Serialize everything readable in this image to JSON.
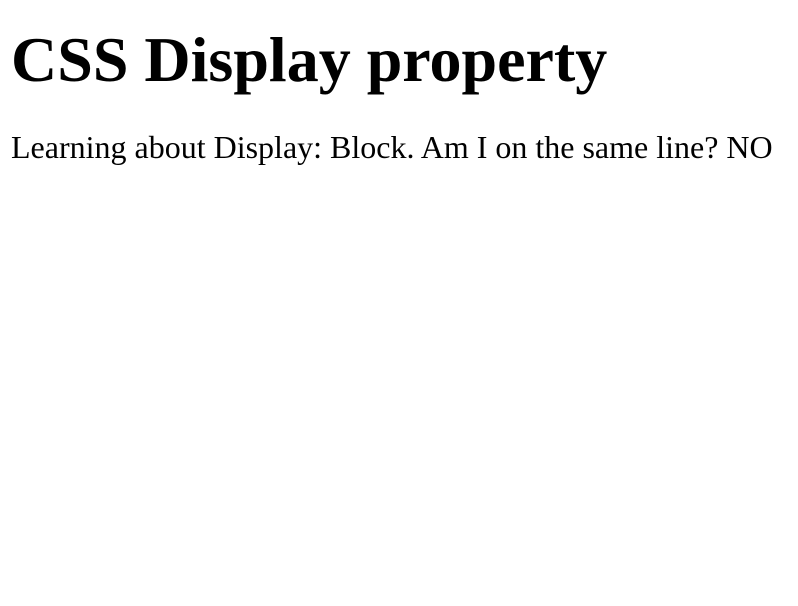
{
  "page": {
    "title": "CSS Display property",
    "body_text": "Learning about Display: Block. Am I on the same line? NO"
  },
  "colors": {
    "background": "#ffffff",
    "text": "#000000"
  }
}
